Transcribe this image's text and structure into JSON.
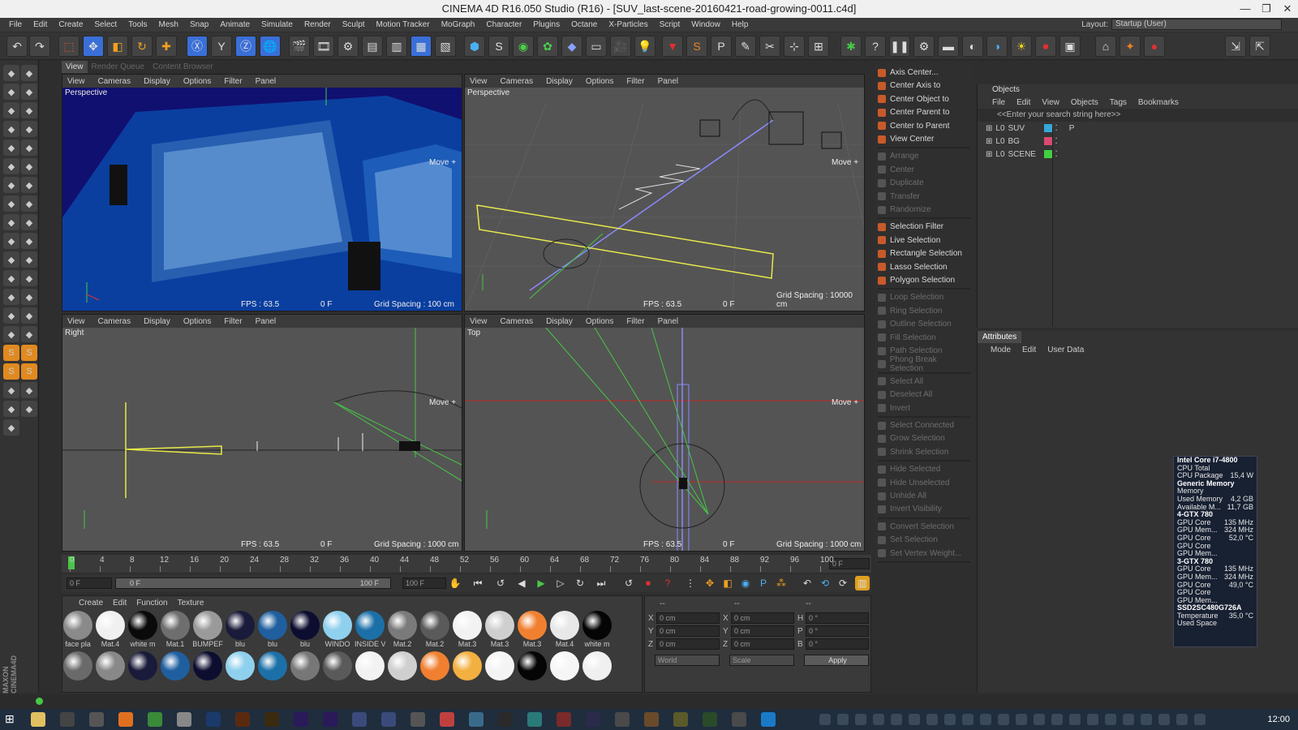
{
  "window": {
    "title": "CINEMA 4D R16.050 Studio (R16) - [SUV_last-scene-20160421-road-growing-0011.c4d]"
  },
  "menu": [
    "File",
    "Edit",
    "Create",
    "Select",
    "Tools",
    "Mesh",
    "Snap",
    "Animate",
    "Simulate",
    "Render",
    "Sculpt",
    "Motion Tracker",
    "MoGraph",
    "Character",
    "Plugins",
    "Octane",
    "X-Particles",
    "Script",
    "Window",
    "Help"
  ],
  "layout": {
    "label": "Layout:",
    "value": "Startup (User)"
  },
  "panel_tabs": [
    "View",
    "Render Queue",
    "Content Browser"
  ],
  "viewport_menu": [
    "View",
    "Cameras",
    "Display",
    "Options",
    "Filter",
    "Panel"
  ],
  "viewports": [
    {
      "name": "Perspective",
      "fps": "FPS : 63.5",
      "frame": "0 F",
      "grid": "Grid Spacing : 100 cm",
      "move": "Move +"
    },
    {
      "name": "Perspective",
      "fps": "FPS : 63.5",
      "frame": "0 F",
      "grid": "Grid Spacing : 10000 cm",
      "move": "Move +"
    },
    {
      "name": "Right",
      "fps": "FPS : 63.5",
      "frame": "0 F",
      "grid": "Grid Spacing : 1000 cm",
      "move": "Move +"
    },
    {
      "name": "Top",
      "fps": "FPS : 63.5",
      "frame": "0 F",
      "grid": "Grid Spacing : 1000 cm",
      "move": "Move +"
    }
  ],
  "timeline": {
    "ticks": [
      "0",
      "4",
      "8",
      "12",
      "16",
      "20",
      "24",
      "28",
      "32",
      "36",
      "40",
      "44",
      "48",
      "52",
      "56",
      "60",
      "64",
      "68",
      "72",
      "76",
      "80",
      "84",
      "88",
      "92",
      "96",
      "100"
    ],
    "current": "0 F",
    "start": "0 F",
    "end": "100 F",
    "range_end": "100 F",
    "range_start": "0 F"
  },
  "materials": {
    "menu": [
      "Create",
      "Edit",
      "Function",
      "Texture"
    ],
    "row1": [
      {
        "name": "face pla",
        "color": "#8a8a8a"
      },
      {
        "name": "Mat.4",
        "color": "#f0f0f0"
      },
      {
        "name": "white m",
        "color": "#0a0a0a"
      },
      {
        "name": "Mat.1",
        "color": "#6e6e6e"
      },
      {
        "name": "BUMPEF",
        "color": "#9a9a9a"
      },
      {
        "name": "blu",
        "color": "#1a1a3a"
      },
      {
        "name": "blu",
        "color": "#1f5f9f"
      },
      {
        "name": "blu",
        "color": "#0d0d30"
      },
      {
        "name": "WINDO",
        "color": "#8fd0ee"
      },
      {
        "name": "INSIDE V",
        "color": "#1c70a8"
      },
      {
        "name": "Mat.2",
        "color": "#7a7a7a"
      },
      {
        "name": "Mat.2",
        "color": "#5a5a5a"
      },
      {
        "name": "Mat.3",
        "color": "#f2f2f2"
      },
      {
        "name": "Mat.3",
        "color": "#cfcfcf"
      },
      {
        "name": "Mat.3",
        "color": "#f08030"
      },
      {
        "name": "Mat.4",
        "color": "#e8e8e8"
      },
      {
        "name": "white m",
        "color": "#050505"
      }
    ],
    "row2": [
      "#6a6a6a",
      "#888888",
      "#1a1a3a",
      "#1f5f9f",
      "#0d0d30",
      "#8fd0ee",
      "#1c70a8",
      "#777777",
      "#5a5a5a",
      "#f2f2f2",
      "#cfcfcf",
      "#f08030",
      "#f2b040",
      "#f4f4f4",
      "#050505",
      "#f6f6f6",
      "#f0f0f0"
    ]
  },
  "coords": {
    "pos": [
      {
        "axis": "X",
        "value": "0 cm"
      },
      {
        "axis": "Y",
        "value": "0 cm"
      },
      {
        "axis": "Z",
        "value": "0 cm"
      }
    ],
    "size": [
      {
        "axis": "X",
        "value": "0 cm"
      },
      {
        "axis": "Y",
        "value": "0 cm"
      },
      {
        "axis": "Z",
        "value": "0 cm"
      }
    ],
    "rot": [
      {
        "axis": "H",
        "value": "0 °"
      },
      {
        "axis": "P",
        "value": "0 °"
      },
      {
        "axis": "B",
        "value": "0 °"
      }
    ],
    "mode": "World",
    "scale": "Scale",
    "apply": "Apply",
    "col1": "--",
    "col2": "--",
    "col3": "--"
  },
  "commands": {
    "group1": [
      "Axis Center...",
      "Center Axis to",
      "Center Object to",
      "Center Parent to",
      "Center to Parent",
      "View Center"
    ],
    "group2": [
      "Arrange",
      "Center",
      "Duplicate",
      "Transfer",
      "Randomize"
    ],
    "group3": [
      "Selection Filter",
      "Live Selection",
      "Rectangle Selection",
      "Lasso Selection",
      "Polygon Selection"
    ],
    "group4": [
      "Loop Selection",
      "Ring Selection",
      "Outline Selection",
      "Fill Selection",
      "Path Selection",
      "Phong Break Selection"
    ],
    "group5": [
      "Select All",
      "Deselect All",
      "Invert"
    ],
    "group6": [
      "Select Connected",
      "Grow Selection",
      "Shrink Selection"
    ],
    "group7": [
      "Hide Selected",
      "Hide Unselected",
      "Unhide All",
      "Invert Visibility"
    ],
    "group8": [
      "Convert Selection",
      "Set Selection",
      "Set Vertex Weight..."
    ]
  },
  "objects": {
    "header": "Objects",
    "menu": [
      "File",
      "Edit",
      "View",
      "Objects",
      "Tags",
      "Bookmarks"
    ],
    "search": "<<Enter your search string here>>",
    "items": [
      {
        "name": "SUV",
        "color": "#35a8d8"
      },
      {
        "name": "BG",
        "color": "#d84a70"
      },
      {
        "name": "SCENE",
        "color": "#40d040"
      }
    ]
  },
  "attributes": {
    "tab": "Attributes",
    "menu": [
      "Mode",
      "Edit",
      "User Data"
    ]
  },
  "hwmonitor": [
    {
      "k": "Intel Core i7-4800",
      "v": "",
      "h": true
    },
    {
      "k": "CPU Total",
      "v": ""
    },
    {
      "k": "CPU Package",
      "v": "15,4 W"
    },
    {
      "k": "Generic Memory",
      "v": "",
      "h": true
    },
    {
      "k": "Memory",
      "v": ""
    },
    {
      "k": "Used Memory",
      "v": "4,2 GB"
    },
    {
      "k": "Available M...",
      "v": "11,7 GB"
    },
    {
      "k": "4-GTX 780",
      "v": "",
      "h": true
    },
    {
      "k": "GPU Core",
      "v": "135 MHz"
    },
    {
      "k": "GPU Mem...",
      "v": "324 MHz"
    },
    {
      "k": "GPU Core",
      "v": "52,0 °C"
    },
    {
      "k": "GPU Core",
      "v": ""
    },
    {
      "k": "GPU Mem...",
      "v": ""
    },
    {
      "k": "3-GTX 780",
      "v": "",
      "h": true
    },
    {
      "k": "GPU Core",
      "v": "135 MHz"
    },
    {
      "k": "GPU Mem...",
      "v": "324 MHz"
    },
    {
      "k": "GPU Core",
      "v": "49,0 °C"
    },
    {
      "k": "GPU Core",
      "v": ""
    },
    {
      "k": "GPU Mem...",
      "v": ""
    },
    {
      "k": "SSD2SC480G726A",
      "v": "",
      "h": true
    },
    {
      "k": "Temperature",
      "v": "35,0 °C"
    },
    {
      "k": "Used Space",
      "v": ""
    }
  ],
  "taskbar": {
    "clock": "12:00"
  },
  "colors": {
    "accent": "#3a6fd8",
    "yellow": "#e8e84a",
    "green": "#46c846"
  }
}
